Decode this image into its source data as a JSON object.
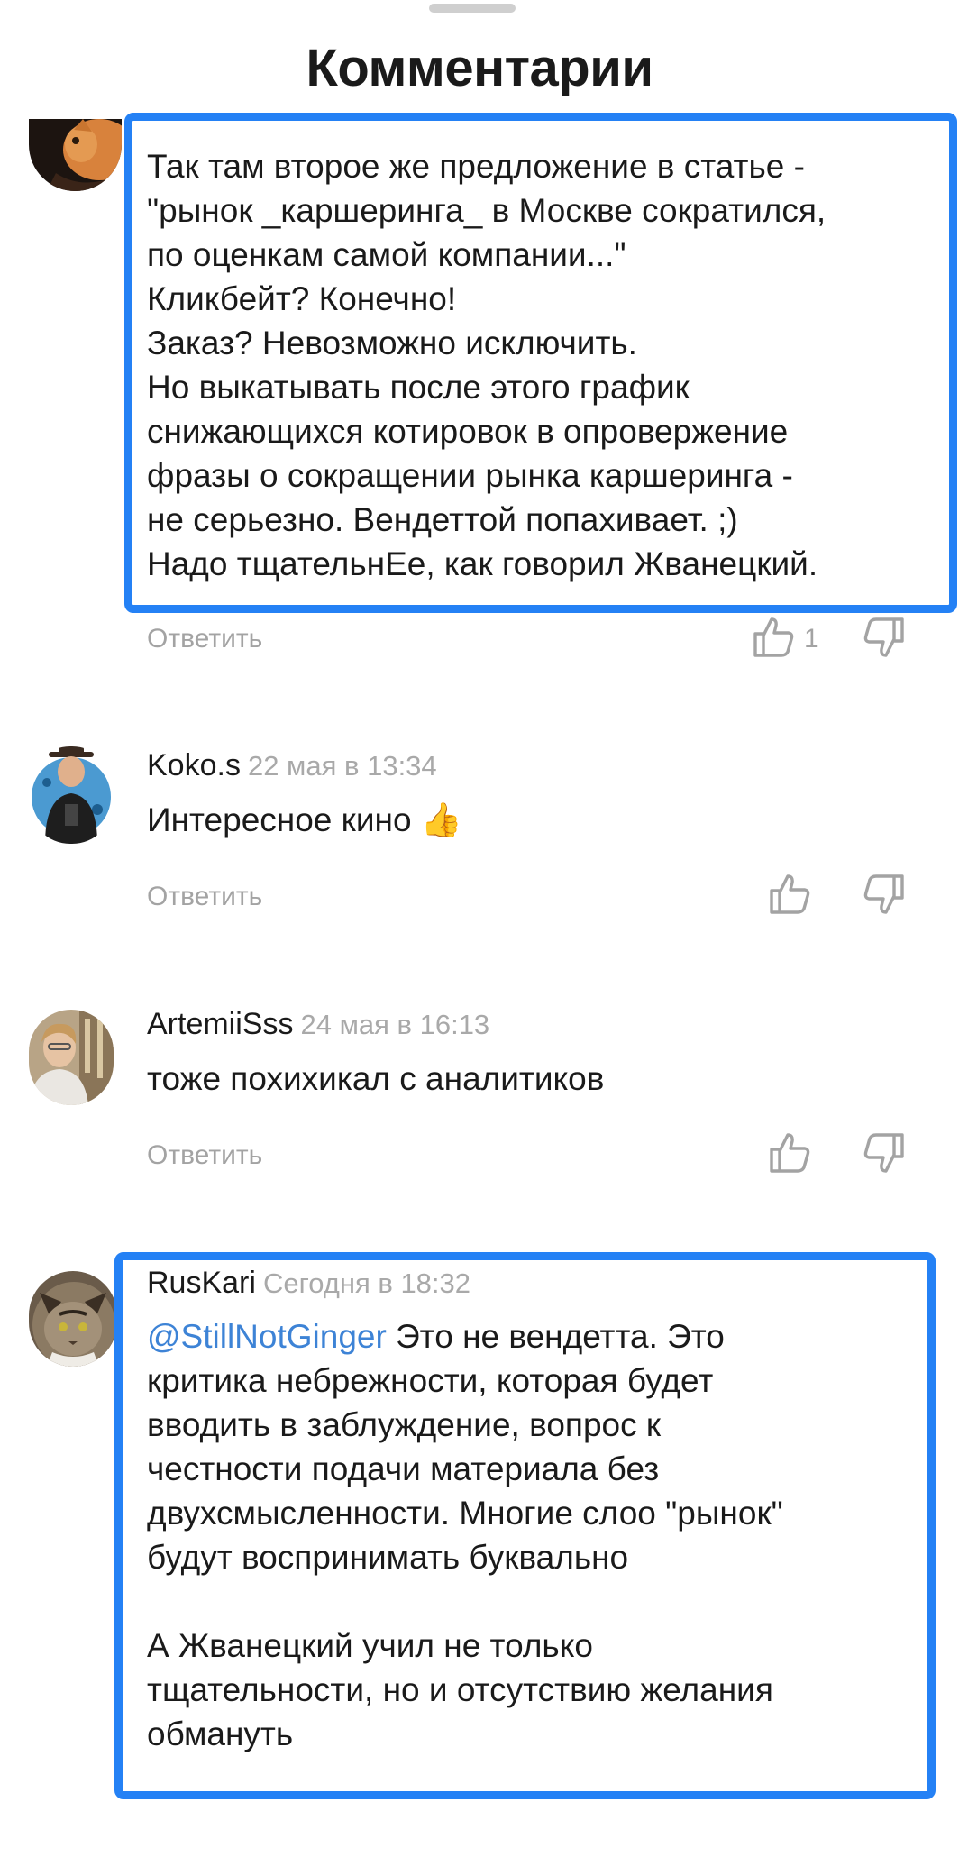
{
  "header": {
    "title": "Комментарии"
  },
  "comments": [
    {
      "text": "Так там второе же предложение в статье -\n\"рынок _каршеринга_ в Москве сократился,\nпо оценкам самой компании...\"\nКликбейт? Конечно!\nЗаказ? Невозможно исключить.\nНо выкатывать после этого график\nснижающихся котировок в опровержение\nфразы о сокращении рынка каршеринга -\nне серьезно. Вендеттой попахивает. ;)\nНадо тщательнЕе, как говорил Жванецкий.",
      "reply_label": "Ответить",
      "likes": "1"
    },
    {
      "author": "Koko.s",
      "date": "22 мая в 13:34",
      "text": "Интересное кино 👍",
      "reply_label": "Ответить"
    },
    {
      "author": "ArtemiiSss",
      "date": "24 мая в 16:13",
      "text": "тоже похихикал с аналитиков",
      "reply_label": "Ответить"
    },
    {
      "author": "RusKari",
      "date": "Сегодня в 18:32",
      "mention": "@StillNotGinger",
      "text": " Это не вендетта. Это\nкритика небрежности, которая будет\nвводить в заблуждение, вопрос к\nчестности подачи материала без\nдвухсмысленности. Многие слоо \"рынок\"\nбудут воспринимать буквально\n\nА Жванецкий учил не только\nтщательности, но и отсутствию желания\nобмануть"
    }
  ],
  "icons": {
    "like": "thumbs-up-icon",
    "dislike": "thumbs-down-icon"
  },
  "colors": {
    "highlight": "#2481f5",
    "mention": "#3d83d6",
    "muted": "#a3a3a3"
  }
}
